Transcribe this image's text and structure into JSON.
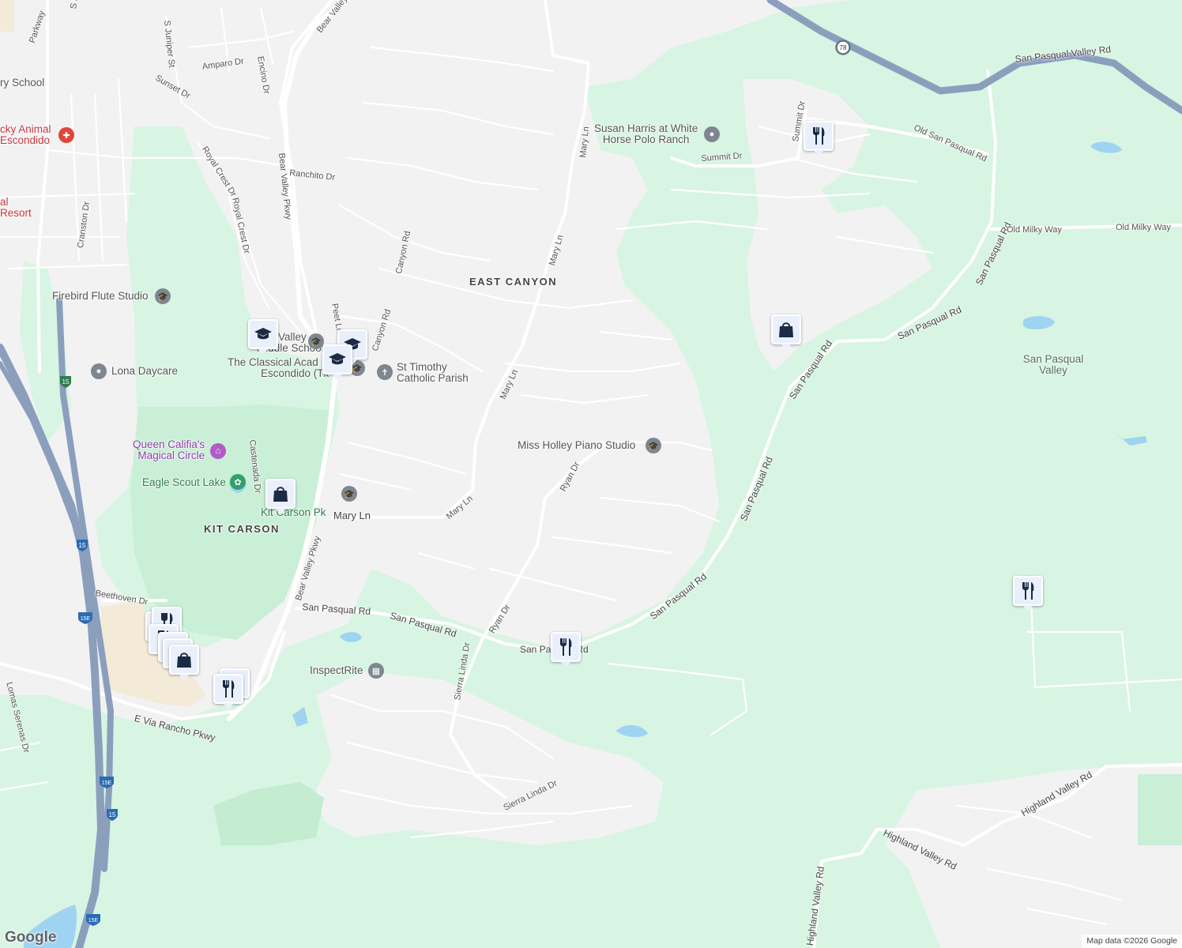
{
  "map": {
    "attribution": "Map data ©2026 Google",
    "logo": "Google",
    "colors": {
      "land": "#f2f2f3",
      "park": "#d5f4e1",
      "water": "#9fd3f2",
      "highway": "#8b9fbd",
      "road": "#ffffff",
      "developed": "#f3e8d6"
    }
  },
  "places": {
    "east_canyon": "EAST CANYON",
    "kit_carson": "KIT CARSON",
    "san_pasqual_valley": "San Pasqual Valley"
  },
  "roads": {
    "bear_valley_pkwy_1": "Bear Valley Pkwy",
    "bear_valley_pkwy_2": "Bear Valley Pkwy",
    "bear_valley_top": "Bear Valley",
    "s_escondido_blvd": "S Escondido Blvd",
    "parkway": "Parkway",
    "s_juniper_st": "S Juniper St",
    "amparo_dr": "Amparo Dr",
    "encino_dr": "Encino Dr",
    "sunset_dr": "Sunset Dr",
    "royal_crest_dr_1": "Royal Crest Dr",
    "royal_crest_dr_2": "Royal Crest Dr",
    "ranchito_dr": "Ranchito Dr",
    "cranston_dr": "Cranston Dr",
    "peet_ln": "Peet Ln",
    "canyon_rd_1": "Canyon Rd",
    "canyon_rd_2": "Canyon Rd",
    "castenada_dr": "Castenada Dr",
    "mary_ln_1": "Mary Ln",
    "mary_ln_2": "Mary Ln",
    "mary_ln_3": "Mary Ln",
    "mary_ln_4": "Mary Ln",
    "mary_ln_5": "Mary Ln",
    "ryan_dr_1": "Ryan Dr",
    "ryan_dr_2": "Ryan Dr",
    "sierra_linda_dr_1": "Sierra Linda Dr",
    "sierra_linda_dr_2": "Sierra Linda Dr",
    "san_pasqual_rd_1": "San Pasqual Rd",
    "san_pasqual_rd_2": "San Pasqual Rd",
    "san_pasqual_rd_3": "San Pasqual Rd",
    "san_pasqual_rd_4": "San Pasqual Rd",
    "san_pasqual_rd_5": "San Pasqual Rd",
    "san_pasqual_rd_6": "San Pasqual Rd",
    "san_pasqual_rd_7": "San Pasqual Rd",
    "san_pasqual_rd_8": "San Pasqual Rd",
    "san_pasqual_valley_rd": "San Pasqual Valley Rd",
    "old_san_pasqual_rd": "Old San Pasqual Rd",
    "summit_dr_1": "Summit Dr",
    "summit_dr_2": "Summit Dr",
    "old_milky_way_1": "Old Milky Way",
    "old_milky_way_2": "Old Milky Way",
    "beethoven_dr": "Beethoven Dr",
    "e_via_rancho_pkwy": "E Via Rancho Pkwy",
    "lomas_serenas_dr": "Lomas Serenas Dr",
    "highland_valley_rd_1": "Highland Valley Rd",
    "highland_valley_rd_2": "Highland Valley Rd",
    "highland_valley_rd_3": "Highland Valley Rd"
  },
  "shields": {
    "sr78": "78",
    "i15_a": "15",
    "i15_b": "15",
    "i15e_a": "15E",
    "i15e_b": "15E",
    "i15_c": "15",
    "i15e_c": "15E"
  },
  "pois": {
    "ry_school": "ry School",
    "animal_1": "cky Animal",
    "animal_2": "Escondido",
    "resort_1": "al",
    "resort_2": "Resort",
    "firebird": "Firebird Flute Studio",
    "lona": "Lona Daycare",
    "valley_ms_1": "Valley",
    "valley_ms_2": "Middle School",
    "classical_1": "The Classical Acad",
    "classical_2": "Escondido (Tk",
    "st_timothy_1": "St Timothy",
    "st_timothy_2": "Catholic Parish",
    "queen_califia_1": "Queen Califia's",
    "queen_califia_2": "Magical Circle",
    "eagle_scout": "Eagle Scout Lake",
    "kit_carson_pk": "Kit Carson Pk",
    "susan_harris_1": "Susan Harris at White",
    "susan_harris_2": "Horse Polo Ranch",
    "miss_holley": "Miss Holley Piano Studio",
    "inspectrite": "InspectRite"
  },
  "markers": [
    {
      "icon": "school-icon",
      "label": "school"
    },
    {
      "icon": "school-icon",
      "label": "school"
    },
    {
      "icon": "school-icon",
      "label": "school"
    },
    {
      "icon": "shopping-bag-icon",
      "label": "shopping"
    },
    {
      "icon": "shopping-bag-icon",
      "label": "shopping"
    },
    {
      "icon": "restaurant-icon",
      "label": "restaurant"
    },
    {
      "icon": "restaurant-icon",
      "label": "restaurant"
    },
    {
      "icon": "restaurant-icon",
      "label": "restaurant"
    },
    {
      "icon": "restaurant-icon",
      "label": "restaurant"
    },
    {
      "icon": "shopping-bag-icon",
      "label": "shopping"
    }
  ]
}
